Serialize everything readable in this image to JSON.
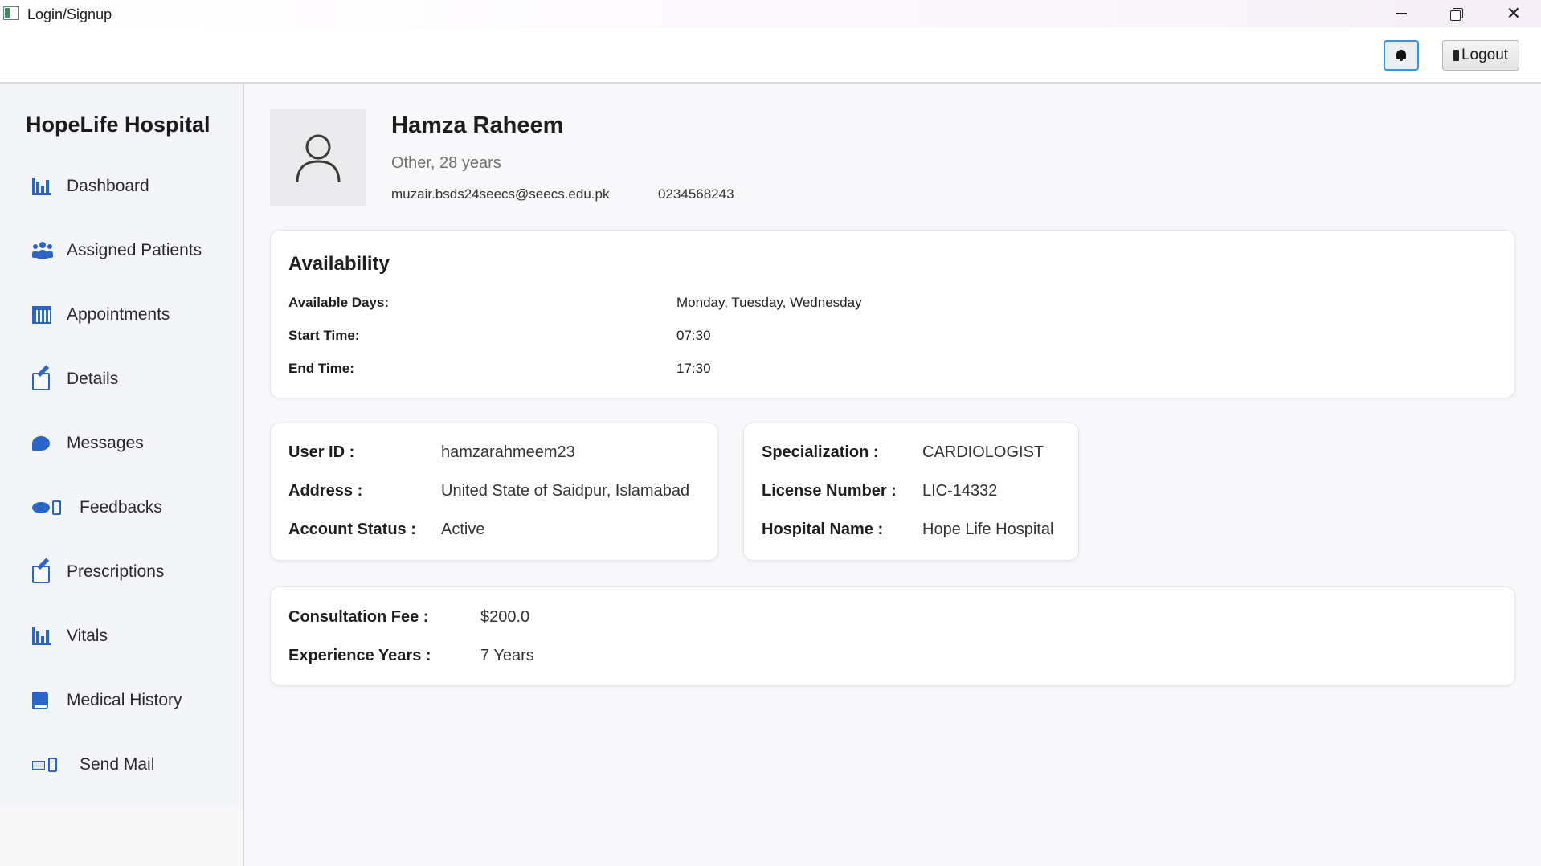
{
  "window": {
    "title": "Login/Signup"
  },
  "toolbar": {
    "logout_label": "Logout"
  },
  "sidebar": {
    "brand": "HopeLife Hospital",
    "items": [
      {
        "label": "Dashboard",
        "icon": "chart-icon"
      },
      {
        "label": "Assigned Patients",
        "icon": "users-icon"
      },
      {
        "label": "Appointments",
        "icon": "calendar-icon"
      },
      {
        "label": "Details",
        "icon": "edit-icon"
      },
      {
        "label": "Messages",
        "icon": "chat-bubble-icon"
      },
      {
        "label": "Feedbacks",
        "icon": "feedback-icon"
      },
      {
        "label": "Prescriptions",
        "icon": "edit-icon"
      },
      {
        "label": "Vitals",
        "icon": "chart-icon"
      },
      {
        "label": "Medical History",
        "icon": "book-icon"
      },
      {
        "label": "Send Mail",
        "icon": "mail-icon"
      }
    ]
  },
  "profile": {
    "name": "Hamza Raheem",
    "gender_age": "Other, 28 years",
    "email": "muzair.bsds24seecs@seecs.edu.pk",
    "phone": "0234568243"
  },
  "availability": {
    "title": "Availability",
    "days_label": "Available Days:",
    "days_value": "Monday, Tuesday, Wednesday",
    "start_label": "Start Time:",
    "start_value": "07:30",
    "end_label": "End Time:",
    "end_value": "17:30"
  },
  "account": {
    "user_id_label": "User ID :",
    "user_id_value": "hamzarahmeem23",
    "address_label": "Address :",
    "address_value": "United State of Saidpur, Islamabad",
    "status_label": "Account Status :",
    "status_value": "Active"
  },
  "professional": {
    "specialization_label": "Specialization :",
    "specialization_value": "CARDIOLOGIST",
    "license_label": "License Number :",
    "license_value": "LIC-14332",
    "hospital_label": "Hospital Name :",
    "hospital_value": "Hope Life Hospital"
  },
  "fees": {
    "fee_label": "Consultation Fee :",
    "fee_value": "$200.0",
    "experience_label": "Experience Years :",
    "experience_value": "7 Years"
  },
  "colors": {
    "accent": "#2a66c8",
    "bell_border": "#3a93d8"
  }
}
